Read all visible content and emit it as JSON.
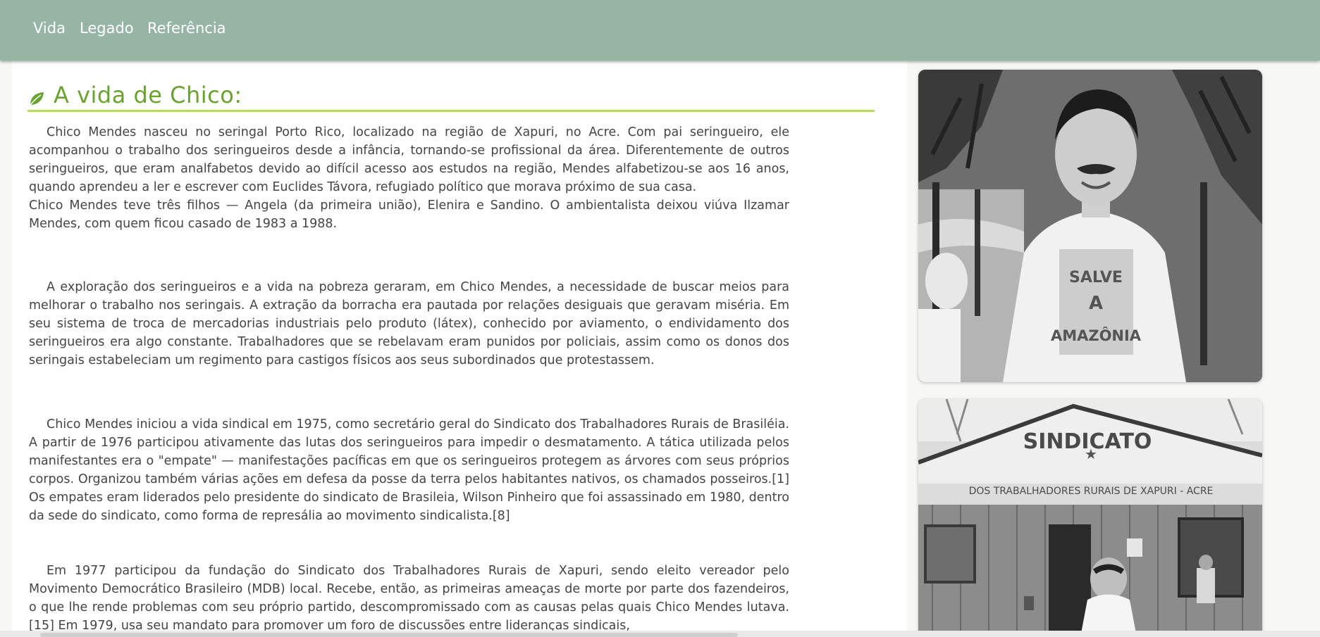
{
  "nav": {
    "items": [
      {
        "label": "Vida"
      },
      {
        "label": "Legado"
      },
      {
        "label": "Referência"
      }
    ]
  },
  "section": {
    "title": "A vida de Chico:",
    "paragraphs": [
      {
        "lines": [
          "Chico Mendes nasceu no seringal Porto Rico, localizado na região de Xapuri, no Acre. Com pai seringueiro, ele acompanhou o trabalho dos seringueiros desde a infância, tornando-se profissional da área. Diferentemente de outros seringueiros, que eram analfabetos devido ao difícil acesso aos estudos na região, Mendes alfabetizou-se aos 16 anos, quando aprendeu a ler e escrever com Euclides Távora, refugiado político que morava próximo de sua casa.",
          "Chico Mendes teve três filhos — Angela (da primeira união), Elenira e Sandino. O ambientalista deixou viúva Ilzamar Mendes, com quem ficou casado de 1983 a 1988."
        ]
      },
      {
        "text": "A exploração dos seringueiros e a vida na pobreza geraram, em Chico Mendes, a necessidade de buscar meios para melhorar o trabalho nos seringais. A extração da borracha era pautada por relações desiguais que geravam miséria. Em seu sistema de troca de mercadorias industriais pelo produto (látex), conhecido por aviamento, o endividamento dos seringueiros era algo constante. Trabalhadores que se rebelavam eram punidos por policiais, assim como os donos dos seringais estabeleciam um regimento para castigos físicos aos seus subordinados que protestassem."
      },
      {
        "text": "Chico Mendes iniciou a vida sindical em 1975, como secretário geral do Sindicato dos Trabalhadores Rurais de Brasiléia. A partir de 1976 participou ativamente das lutas dos seringueiros para impedir o desmatamento. A tática utilizada pelos manifestantes era o \"empate\" — manifestações pacíficas em que os seringueiros protegem as árvores com seus próprios corpos. Organizou também várias ações em defesa da posse da terra pelos habitantes nativos, os chamados posseiros.[1] Os empates eram liderados pelo presidente do sindicato de Brasileia, Wilson Pinheiro que foi assassinado em 1980, dentro da sede do sindicato, como forma de represália ao movimento sindicalista.[8]"
      },
      {
        "text": "Em 1977 participou da fundação do Sindicato dos Trabalhadores Rurais de Xapuri, sendo eleito vereador pelo Movimento Democrático Brasileiro (MDB) local. Recebe, então, as primeiras ameaças de morte por parte dos fazendeiros, o que lhe rende problemas com seu próprio partido, descompromissado com as causas pelas quais Chico Mendes lutava.[15] Em 1979, usa seu mandato para promover um foro de discussões entre lideranças sindicais,"
      }
    ]
  },
  "photos": [
    {
      "shirt_text": [
        "SALVE",
        "A",
        "AMAZÔNIA"
      ]
    },
    {
      "sign_title": "SINDICATO",
      "sign_subtitle": "DOS TRABALHADORES RURAIS DE XAPURI - ACRE"
    }
  ],
  "colors": {
    "navbar": "#97b5a5",
    "heading": "#6aa232",
    "heading_rule": "#b8d96e"
  }
}
